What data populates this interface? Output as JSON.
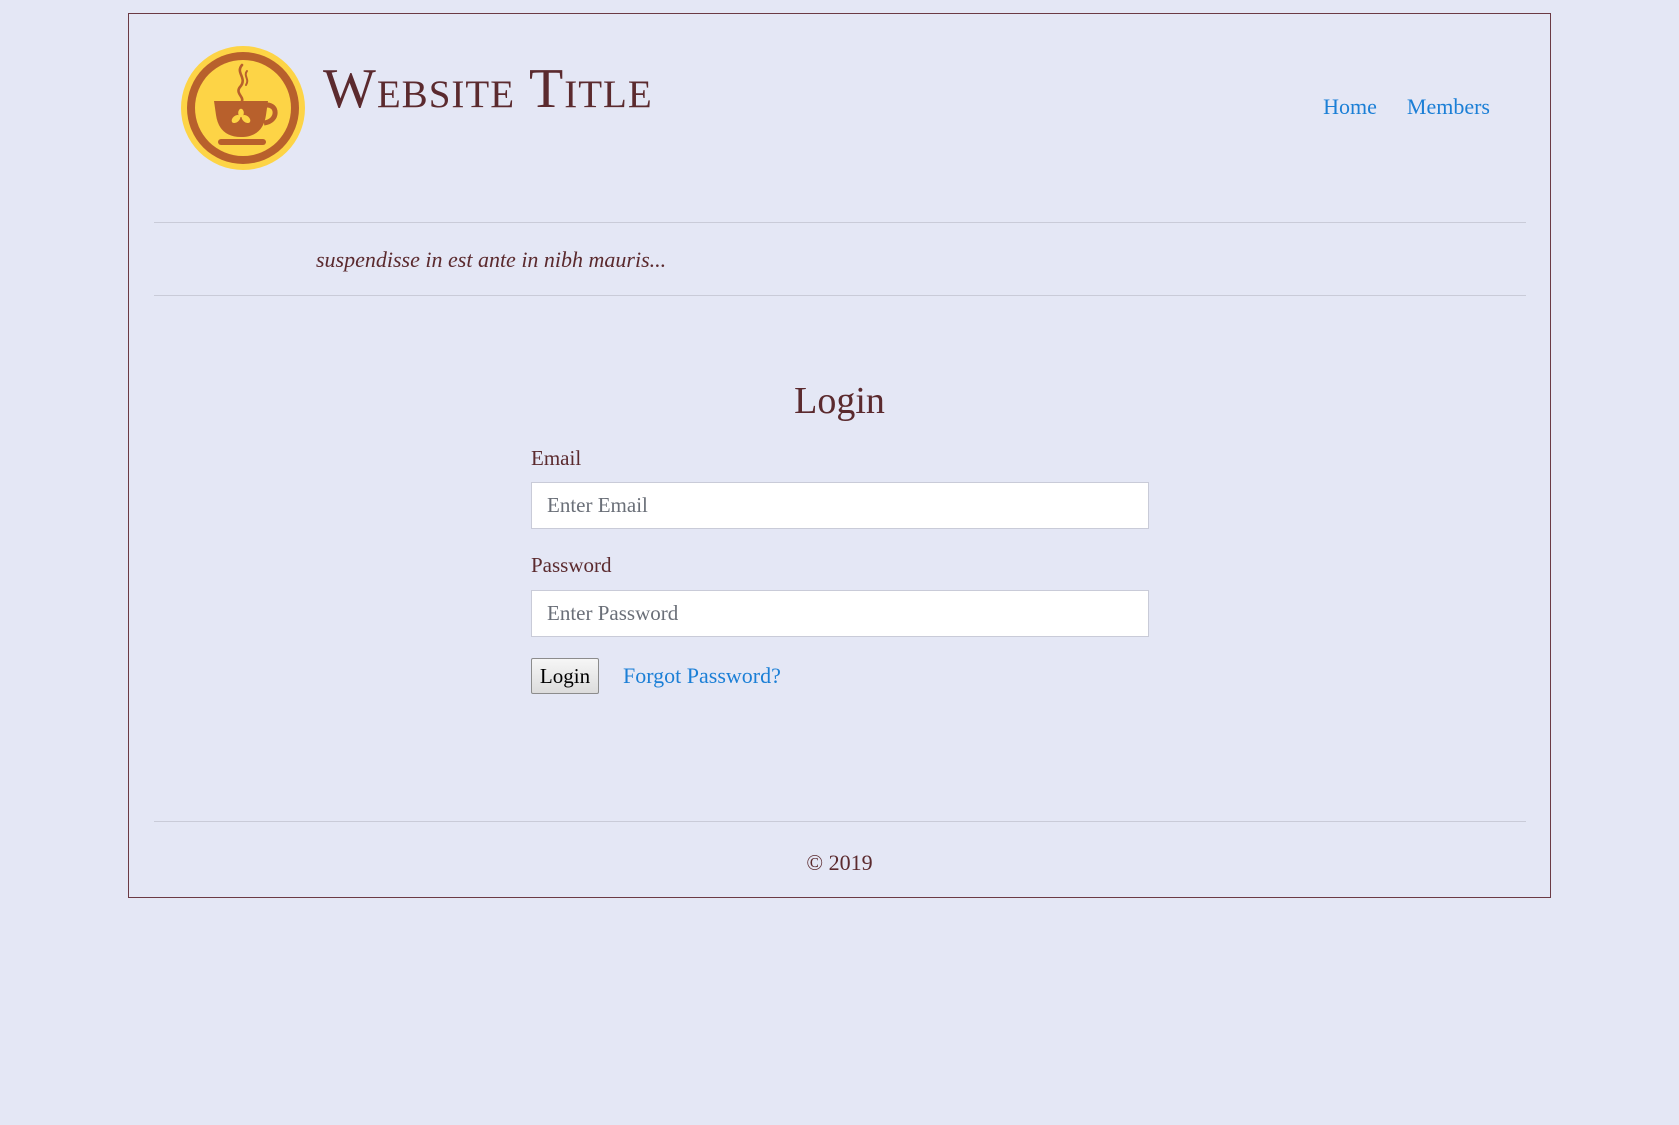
{
  "header": {
    "site_title": "Website Title",
    "logo_icon": "coffee-cup-icon",
    "nav": [
      {
        "label": "Home"
      },
      {
        "label": "Members"
      }
    ]
  },
  "tagline": "suspendisse in est ante in nibh mauris...",
  "login_form": {
    "heading": "Login",
    "email_label": "Email",
    "email_placeholder": "Enter Email",
    "email_value": "",
    "password_label": "Password",
    "password_placeholder": "Enter Password",
    "password_value": "",
    "submit_label": "Login",
    "forgot_label": "Forgot Password?"
  },
  "footer": {
    "copyright": "© 2019"
  },
  "colors": {
    "page_background": "#e4e7f5",
    "text": "#5b2a2e",
    "link": "#1b7fd6",
    "frame_border": "#6b3a44",
    "logo_ring": "#b8602c",
    "logo_fill": "#fdd446"
  }
}
